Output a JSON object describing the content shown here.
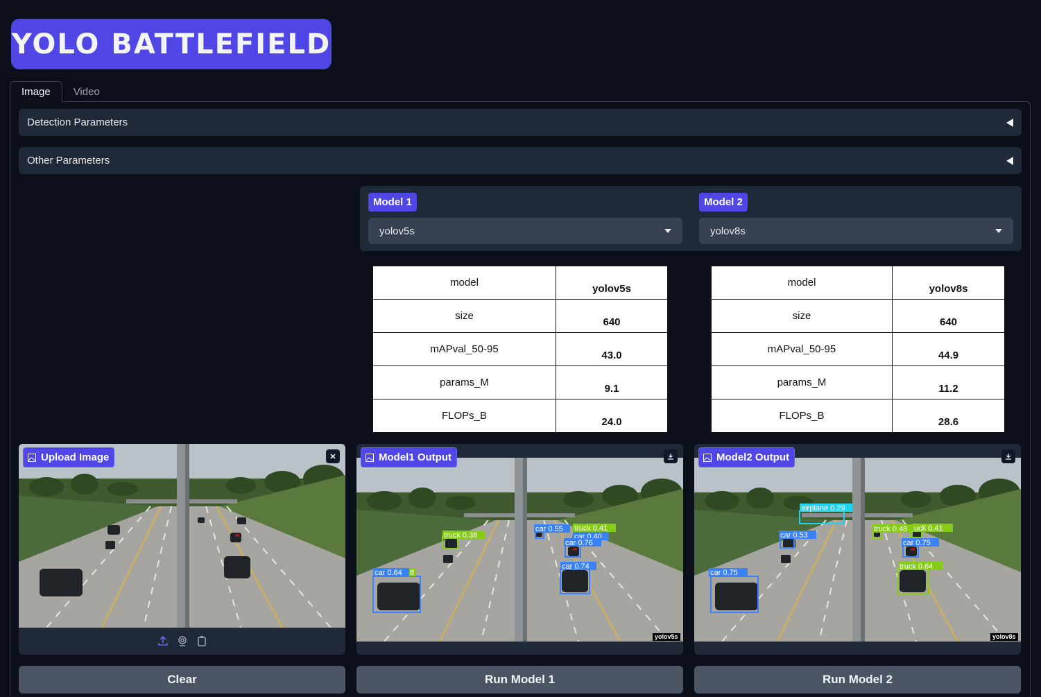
{
  "app": {
    "title": "YOLO BATTLEFIELD"
  },
  "tabs": [
    {
      "label": "Image",
      "active": true
    },
    {
      "label": "Video",
      "active": false
    }
  ],
  "accordions": {
    "detection": "Detection Parameters",
    "other": "Other Parameters"
  },
  "model1": {
    "label": "Model 1",
    "selected": "yolov5s"
  },
  "model2": {
    "label": "Model 2",
    "selected": "yolov8s"
  },
  "table1": {
    "rows": [
      {
        "key": "model",
        "value": "yolov5s"
      },
      {
        "key": "size",
        "value": "640"
      },
      {
        "key": "mAPval_50-95",
        "value": "43.0"
      },
      {
        "key": "params_M",
        "value": "9.1"
      },
      {
        "key": "FLOPs_B",
        "value": "24.0"
      }
    ]
  },
  "table2": {
    "rows": [
      {
        "key": "model",
        "value": "yolov8s"
      },
      {
        "key": "size",
        "value": "640"
      },
      {
        "key": "mAPval_50-95",
        "value": "44.9"
      },
      {
        "key": "params_M",
        "value": "11.2"
      },
      {
        "key": "FLOPs_B",
        "value": "28.6"
      }
    ]
  },
  "upload": {
    "label": "Upload Image"
  },
  "output1": {
    "label": "Model1 Output",
    "tag": "yolov5s",
    "detections": [
      "truck 0.38",
      "car 0.55",
      "truck 0.41",
      "car 0.40",
      "car 0.76",
      "car 0.74",
      "car 0.64",
      "8"
    ]
  },
  "output2": {
    "label": "Model2 Output",
    "tag": "yolov8s",
    "detections": [
      "airplane 0.29",
      "car 0.53",
      "truck 0.48",
      "uck 0.41",
      "car 0.75",
      "truck 0.64",
      "car 0.75"
    ]
  },
  "buttons": {
    "clear": "Clear",
    "run1": "Run Model 1",
    "run2": "Run Model 2"
  },
  "icons": {
    "upload": "upload-icon",
    "webcam": "webcam-icon",
    "clipboard": "clipboard-icon",
    "close": "close-icon",
    "download": "download-icon",
    "image": "image-icon"
  },
  "colors": {
    "accent": "#4f46e5",
    "background": "#0b0f19",
    "panel": "#1f2937",
    "car_box": "#3b82f6",
    "truck_box": "#84cc16",
    "airplane_box": "#22d3ee"
  }
}
